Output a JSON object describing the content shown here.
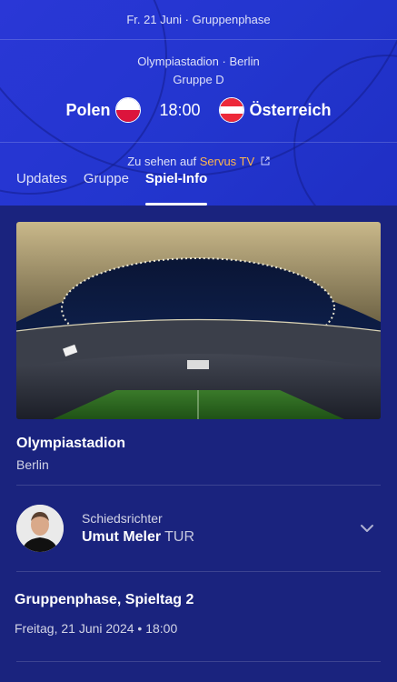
{
  "header": {
    "date_phase": "Fr. 21 Juni · Gruppenphase",
    "venue_line": "Olympiastadion · Berlin",
    "group": "Gruppe D",
    "home_team": "Polen",
    "away_team": "Österreich",
    "kickoff": "18:00",
    "broadcast_prefix": "Zu sehen auf",
    "broadcast_channel": "Servus TV",
    "external_icon": "external-link-icon"
  },
  "tabs": [
    {
      "label": "Updates",
      "active": false
    },
    {
      "label": "Gruppe",
      "active": false
    },
    {
      "label": "Spiel-Info",
      "active": true
    }
  ],
  "venue": {
    "name": "Olympiastadion",
    "city": "Berlin"
  },
  "referee": {
    "role": "Schiedsrichter",
    "name": "Umut Meler",
    "nationality": "TUR"
  },
  "match_info": {
    "phase": "Gruppenphase, Spieltag 2",
    "datetime": "Freitag, 21 Juni 2024 • 18:00"
  },
  "colors": {
    "header_bg": "#2336cf",
    "body_bg": "#1a237e",
    "broadcast_accent": "#ffb74d"
  }
}
